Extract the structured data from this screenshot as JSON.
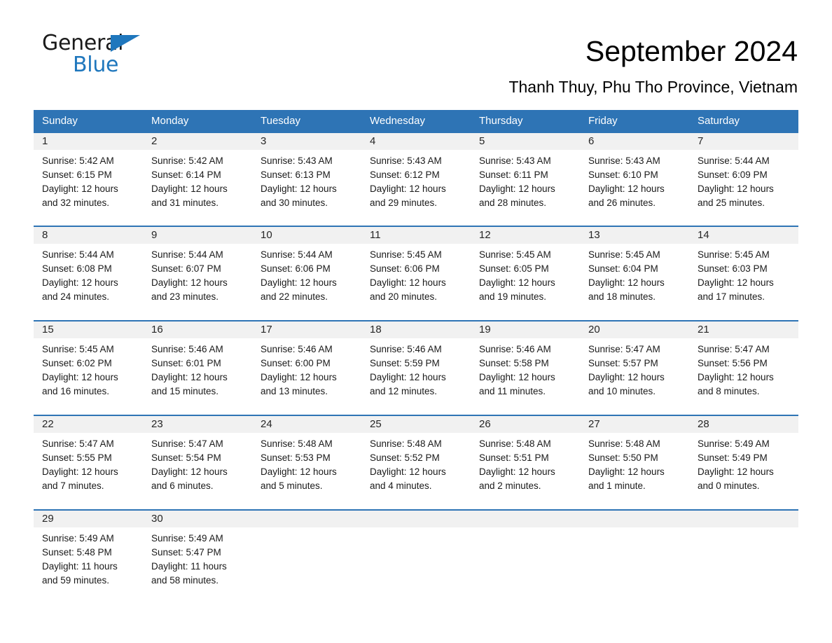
{
  "brand": {
    "name_top": "General",
    "name_bottom": "Blue",
    "triangle_icon": "triangle-icon",
    "accent_color": "#1f77bd"
  },
  "header": {
    "month_title": "September 2024",
    "location": "Thanh Thuy, Phu Tho Province, Vietnam"
  },
  "colors": {
    "header_blue": "#2e74b5",
    "daynum_band": "#f1f1f1",
    "text": "#1a1a1a"
  },
  "weekdays": [
    "Sunday",
    "Monday",
    "Tuesday",
    "Wednesday",
    "Thursday",
    "Friday",
    "Saturday"
  ],
  "weeks": [
    {
      "days": [
        {
          "num": "1",
          "sunrise": "Sunrise: 5:42 AM",
          "sunset": "Sunset: 6:15 PM",
          "daylight_1": "Daylight: 12 hours",
          "daylight_2": "and 32 minutes."
        },
        {
          "num": "2",
          "sunrise": "Sunrise: 5:42 AM",
          "sunset": "Sunset: 6:14 PM",
          "daylight_1": "Daylight: 12 hours",
          "daylight_2": "and 31 minutes."
        },
        {
          "num": "3",
          "sunrise": "Sunrise: 5:43 AM",
          "sunset": "Sunset: 6:13 PM",
          "daylight_1": "Daylight: 12 hours",
          "daylight_2": "and 30 minutes."
        },
        {
          "num": "4",
          "sunrise": "Sunrise: 5:43 AM",
          "sunset": "Sunset: 6:12 PM",
          "daylight_1": "Daylight: 12 hours",
          "daylight_2": "and 29 minutes."
        },
        {
          "num": "5",
          "sunrise": "Sunrise: 5:43 AM",
          "sunset": "Sunset: 6:11 PM",
          "daylight_1": "Daylight: 12 hours",
          "daylight_2": "and 28 minutes."
        },
        {
          "num": "6",
          "sunrise": "Sunrise: 5:43 AM",
          "sunset": "Sunset: 6:10 PM",
          "daylight_1": "Daylight: 12 hours",
          "daylight_2": "and 26 minutes."
        },
        {
          "num": "7",
          "sunrise": "Sunrise: 5:44 AM",
          "sunset": "Sunset: 6:09 PM",
          "daylight_1": "Daylight: 12 hours",
          "daylight_2": "and 25 minutes."
        }
      ]
    },
    {
      "days": [
        {
          "num": "8",
          "sunrise": "Sunrise: 5:44 AM",
          "sunset": "Sunset: 6:08 PM",
          "daylight_1": "Daylight: 12 hours",
          "daylight_2": "and 24 minutes."
        },
        {
          "num": "9",
          "sunrise": "Sunrise: 5:44 AM",
          "sunset": "Sunset: 6:07 PM",
          "daylight_1": "Daylight: 12 hours",
          "daylight_2": "and 23 minutes."
        },
        {
          "num": "10",
          "sunrise": "Sunrise: 5:44 AM",
          "sunset": "Sunset: 6:06 PM",
          "daylight_1": "Daylight: 12 hours",
          "daylight_2": "and 22 minutes."
        },
        {
          "num": "11",
          "sunrise": "Sunrise: 5:45 AM",
          "sunset": "Sunset: 6:06 PM",
          "daylight_1": "Daylight: 12 hours",
          "daylight_2": "and 20 minutes."
        },
        {
          "num": "12",
          "sunrise": "Sunrise: 5:45 AM",
          "sunset": "Sunset: 6:05 PM",
          "daylight_1": "Daylight: 12 hours",
          "daylight_2": "and 19 minutes."
        },
        {
          "num": "13",
          "sunrise": "Sunrise: 5:45 AM",
          "sunset": "Sunset: 6:04 PM",
          "daylight_1": "Daylight: 12 hours",
          "daylight_2": "and 18 minutes."
        },
        {
          "num": "14",
          "sunrise": "Sunrise: 5:45 AM",
          "sunset": "Sunset: 6:03 PM",
          "daylight_1": "Daylight: 12 hours",
          "daylight_2": "and 17 minutes."
        }
      ]
    },
    {
      "days": [
        {
          "num": "15",
          "sunrise": "Sunrise: 5:45 AM",
          "sunset": "Sunset: 6:02 PM",
          "daylight_1": "Daylight: 12 hours",
          "daylight_2": "and 16 minutes."
        },
        {
          "num": "16",
          "sunrise": "Sunrise: 5:46 AM",
          "sunset": "Sunset: 6:01 PM",
          "daylight_1": "Daylight: 12 hours",
          "daylight_2": "and 15 minutes."
        },
        {
          "num": "17",
          "sunrise": "Sunrise: 5:46 AM",
          "sunset": "Sunset: 6:00 PM",
          "daylight_1": "Daylight: 12 hours",
          "daylight_2": "and 13 minutes."
        },
        {
          "num": "18",
          "sunrise": "Sunrise: 5:46 AM",
          "sunset": "Sunset: 5:59 PM",
          "daylight_1": "Daylight: 12 hours",
          "daylight_2": "and 12 minutes."
        },
        {
          "num": "19",
          "sunrise": "Sunrise: 5:46 AM",
          "sunset": "Sunset: 5:58 PM",
          "daylight_1": "Daylight: 12 hours",
          "daylight_2": "and 11 minutes."
        },
        {
          "num": "20",
          "sunrise": "Sunrise: 5:47 AM",
          "sunset": "Sunset: 5:57 PM",
          "daylight_1": "Daylight: 12 hours",
          "daylight_2": "and 10 minutes."
        },
        {
          "num": "21",
          "sunrise": "Sunrise: 5:47 AM",
          "sunset": "Sunset: 5:56 PM",
          "daylight_1": "Daylight: 12 hours",
          "daylight_2": "and 8 minutes."
        }
      ]
    },
    {
      "days": [
        {
          "num": "22",
          "sunrise": "Sunrise: 5:47 AM",
          "sunset": "Sunset: 5:55 PM",
          "daylight_1": "Daylight: 12 hours",
          "daylight_2": "and 7 minutes."
        },
        {
          "num": "23",
          "sunrise": "Sunrise: 5:47 AM",
          "sunset": "Sunset: 5:54 PM",
          "daylight_1": "Daylight: 12 hours",
          "daylight_2": "and 6 minutes."
        },
        {
          "num": "24",
          "sunrise": "Sunrise: 5:48 AM",
          "sunset": "Sunset: 5:53 PM",
          "daylight_1": "Daylight: 12 hours",
          "daylight_2": "and 5 minutes."
        },
        {
          "num": "25",
          "sunrise": "Sunrise: 5:48 AM",
          "sunset": "Sunset: 5:52 PM",
          "daylight_1": "Daylight: 12 hours",
          "daylight_2": "and 4 minutes."
        },
        {
          "num": "26",
          "sunrise": "Sunrise: 5:48 AM",
          "sunset": "Sunset: 5:51 PM",
          "daylight_1": "Daylight: 12 hours",
          "daylight_2": "and 2 minutes."
        },
        {
          "num": "27",
          "sunrise": "Sunrise: 5:48 AM",
          "sunset": "Sunset: 5:50 PM",
          "daylight_1": "Daylight: 12 hours",
          "daylight_2": "and 1 minute."
        },
        {
          "num": "28",
          "sunrise": "Sunrise: 5:49 AM",
          "sunset": "Sunset: 5:49 PM",
          "daylight_1": "Daylight: 12 hours",
          "daylight_2": "and 0 minutes."
        }
      ]
    },
    {
      "days": [
        {
          "num": "29",
          "sunrise": "Sunrise: 5:49 AM",
          "sunset": "Sunset: 5:48 PM",
          "daylight_1": "Daylight: 11 hours",
          "daylight_2": "and 59 minutes."
        },
        {
          "num": "30",
          "sunrise": "Sunrise: 5:49 AM",
          "sunset": "Sunset: 5:47 PM",
          "daylight_1": "Daylight: 11 hours",
          "daylight_2": "and 58 minutes."
        },
        {
          "num": "",
          "sunrise": "",
          "sunset": "",
          "daylight_1": "",
          "daylight_2": ""
        },
        {
          "num": "",
          "sunrise": "",
          "sunset": "",
          "daylight_1": "",
          "daylight_2": ""
        },
        {
          "num": "",
          "sunrise": "",
          "sunset": "",
          "daylight_1": "",
          "daylight_2": ""
        },
        {
          "num": "",
          "sunrise": "",
          "sunset": "",
          "daylight_1": "",
          "daylight_2": ""
        },
        {
          "num": "",
          "sunrise": "",
          "sunset": "",
          "daylight_1": "",
          "daylight_2": ""
        }
      ]
    }
  ]
}
